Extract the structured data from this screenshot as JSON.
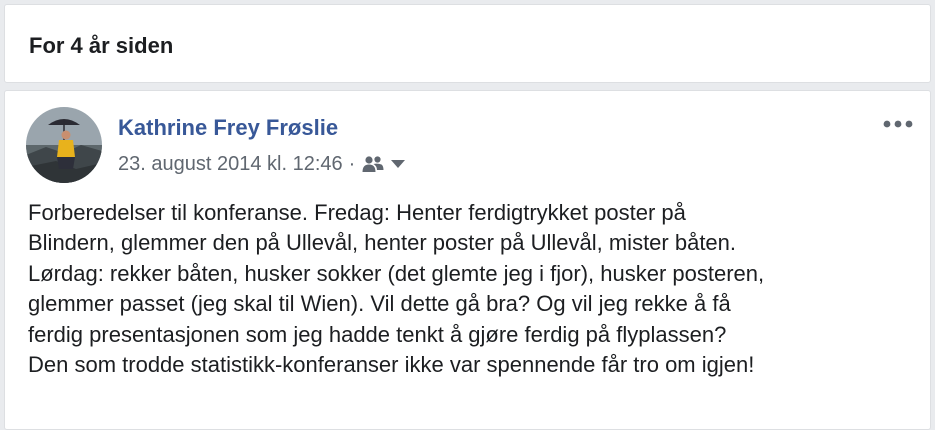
{
  "memory": {
    "title": "For 4 år siden"
  },
  "post": {
    "author": "Kathrine Frey Frøslie",
    "timestamp": "23. august 2014 kl. 12:46",
    "separator": "·",
    "audience_icon": "friends-icon",
    "audience_dropdown_icon": "caret-down-icon",
    "more_icon": "more-options-icon",
    "text": "Forberedelser til konferanse. Fredag: Henter ferdigtrykket poster på\nBlindern, glemmer den på Ullevål, henter poster på Ullevål, mister båten.\nLørdag: rekker båten, husker sokker (det glemte jeg i fjor), husker posteren,\nglemmer passet (jeg skal til Wien). Vil dette gå bra? Og vil jeg rekke å få\nferdig presentasjonen som jeg hadde tenkt å gjøre ferdig på flyplassen?\nDen som trodde statistikk-konferanser ikke var spennende får tro om igjen!"
  },
  "colors": {
    "link": "#385898",
    "meta": "#606770",
    "text": "#1c1e21",
    "background": "#e9ebee"
  }
}
